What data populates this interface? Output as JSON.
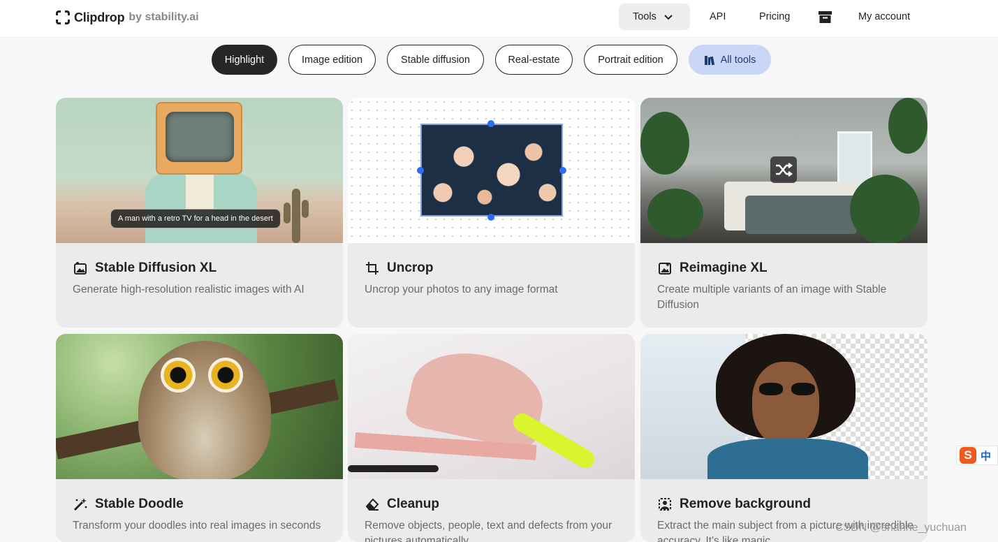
{
  "header": {
    "logo_name": "Clipdrop",
    "logo_by": "by stability.ai",
    "nav": {
      "tools": "Tools",
      "api": "API",
      "pricing": "Pricing",
      "account": "My account"
    }
  },
  "categories": [
    {
      "label": "Highlight",
      "active": true
    },
    {
      "label": "Image edition",
      "active": false
    },
    {
      "label": "Stable diffusion",
      "active": false
    },
    {
      "label": "Real-estate",
      "active": false
    },
    {
      "label": "Portrait edition",
      "active": false
    },
    {
      "label": "All tools",
      "active": false
    }
  ],
  "cards": [
    {
      "title": "Stable Diffusion XL",
      "description": "Generate high-resolution realistic images with AI",
      "image_caption": "A man with a retro TV for a head in the desert"
    },
    {
      "title": "Uncrop",
      "description": "Uncrop your photos to any image format"
    },
    {
      "title": "Reimagine XL",
      "description": "Create multiple variants of an image with Stable Diffusion"
    },
    {
      "title": "Stable Doodle",
      "description": "Transform your doodles into real images in seconds"
    },
    {
      "title": "Cleanup",
      "description": "Remove objects, people, text and defects from your pictures automatically"
    },
    {
      "title": "Remove background",
      "description": "Extract the main subject from a picture with incredible accuracy. It's like magic"
    }
  ],
  "overlay": {
    "ime_label": "中",
    "watermark": "CSDN @shanhe_yuchuan"
  },
  "colors": {
    "active_pill": "#262626",
    "all_tools_pill": "#c9d6f5",
    "card_bg": "#ebebeb"
  }
}
